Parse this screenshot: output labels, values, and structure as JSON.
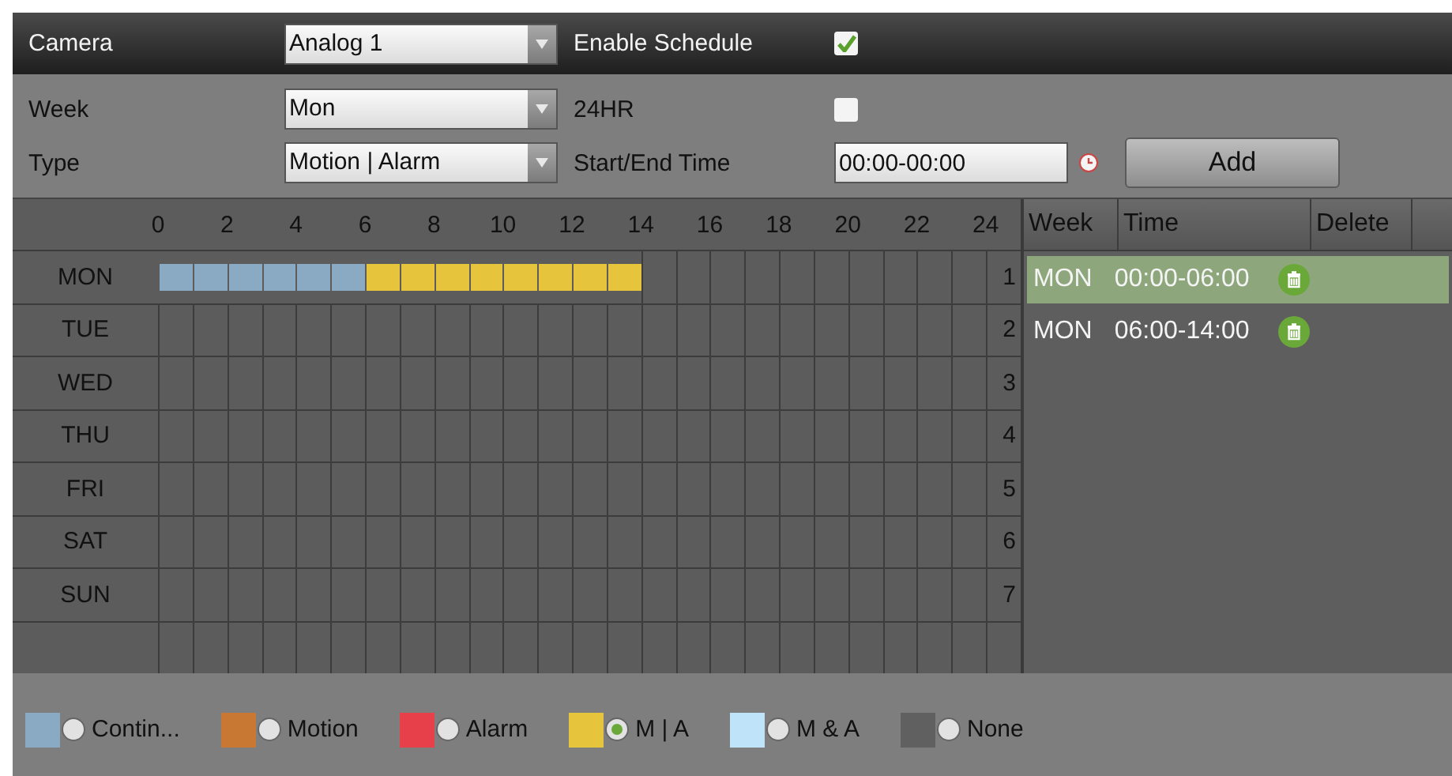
{
  "top": {
    "camera": {
      "label": "Camera",
      "value": "Analog 1"
    },
    "enable": {
      "label": "Enable Schedule",
      "checked": true
    }
  },
  "form": {
    "week": {
      "label": "Week",
      "value": "Mon"
    },
    "hr24": {
      "label": "24HR",
      "checked": false
    },
    "type": {
      "label": "Type",
      "value": "Motion | Alarm"
    },
    "time": {
      "label": "Start/End Time",
      "value": "00:00-00:00"
    },
    "add": "Add"
  },
  "schedule": {
    "hours": [
      "0",
      "2",
      "4",
      "6",
      "8",
      "10",
      "12",
      "14",
      "16",
      "18",
      "20",
      "22",
      "24"
    ],
    "days": [
      {
        "label": "MON",
        "number": "1",
        "slots": [
          {
            "filled": true,
            "color": "#8aaac4"
          },
          {
            "filled": true,
            "color": "#8aaac4"
          },
          {
            "filled": true,
            "color": "#8aaac4"
          },
          {
            "filled": true,
            "color": "#8aaac4"
          },
          {
            "filled": true,
            "color": "#8aaac4"
          },
          {
            "filled": true,
            "color": "#8aaac4"
          },
          {
            "filled": true,
            "color": "#e6c43c"
          },
          {
            "filled": true,
            "color": "#e6c43c"
          },
          {
            "filled": true,
            "color": "#e6c43c"
          },
          {
            "filled": true,
            "color": "#e6c43c"
          },
          {
            "filled": true,
            "color": "#e6c43c"
          },
          {
            "filled": true,
            "color": "#e6c43c"
          },
          {
            "filled": true,
            "color": "#e6c43c"
          },
          {
            "filled": true,
            "color": "#e6c43c"
          },
          {
            "filled": false
          },
          {
            "filled": false
          },
          {
            "filled": false
          },
          {
            "filled": false
          },
          {
            "filled": false
          },
          {
            "filled": false
          },
          {
            "filled": false
          },
          {
            "filled": false
          },
          {
            "filled": false
          },
          {
            "filled": false
          }
        ]
      },
      {
        "label": "TUE",
        "number": "2"
      },
      {
        "label": "WED",
        "number": "3"
      },
      {
        "label": "THU",
        "number": "4"
      },
      {
        "label": "FRI",
        "number": "5"
      },
      {
        "label": "SAT",
        "number": "6"
      },
      {
        "label": "SUN",
        "number": "7"
      }
    ]
  },
  "list": {
    "columns": [
      "Week",
      "Time",
      "Delete"
    ],
    "rows": [
      {
        "week": "MON",
        "time": "00:00-06:00",
        "selected": true
      },
      {
        "week": "MON",
        "time": "06:00-14:00",
        "selected": false
      }
    ]
  },
  "legend": [
    {
      "label": "Contin...",
      "color": "#8aaac4",
      "selected": false
    },
    {
      "label": "Motion",
      "color": "#c87832",
      "selected": false
    },
    {
      "label": "Alarm",
      "color": "#e8404a",
      "selected": false
    },
    {
      "label": "M | A",
      "color": "#e6c43c",
      "selected": true
    },
    {
      "label": "M & A",
      "color": "#bfe3f8",
      "selected": false
    },
    {
      "label": "None",
      "color": "#606060",
      "selected": false
    }
  ]
}
